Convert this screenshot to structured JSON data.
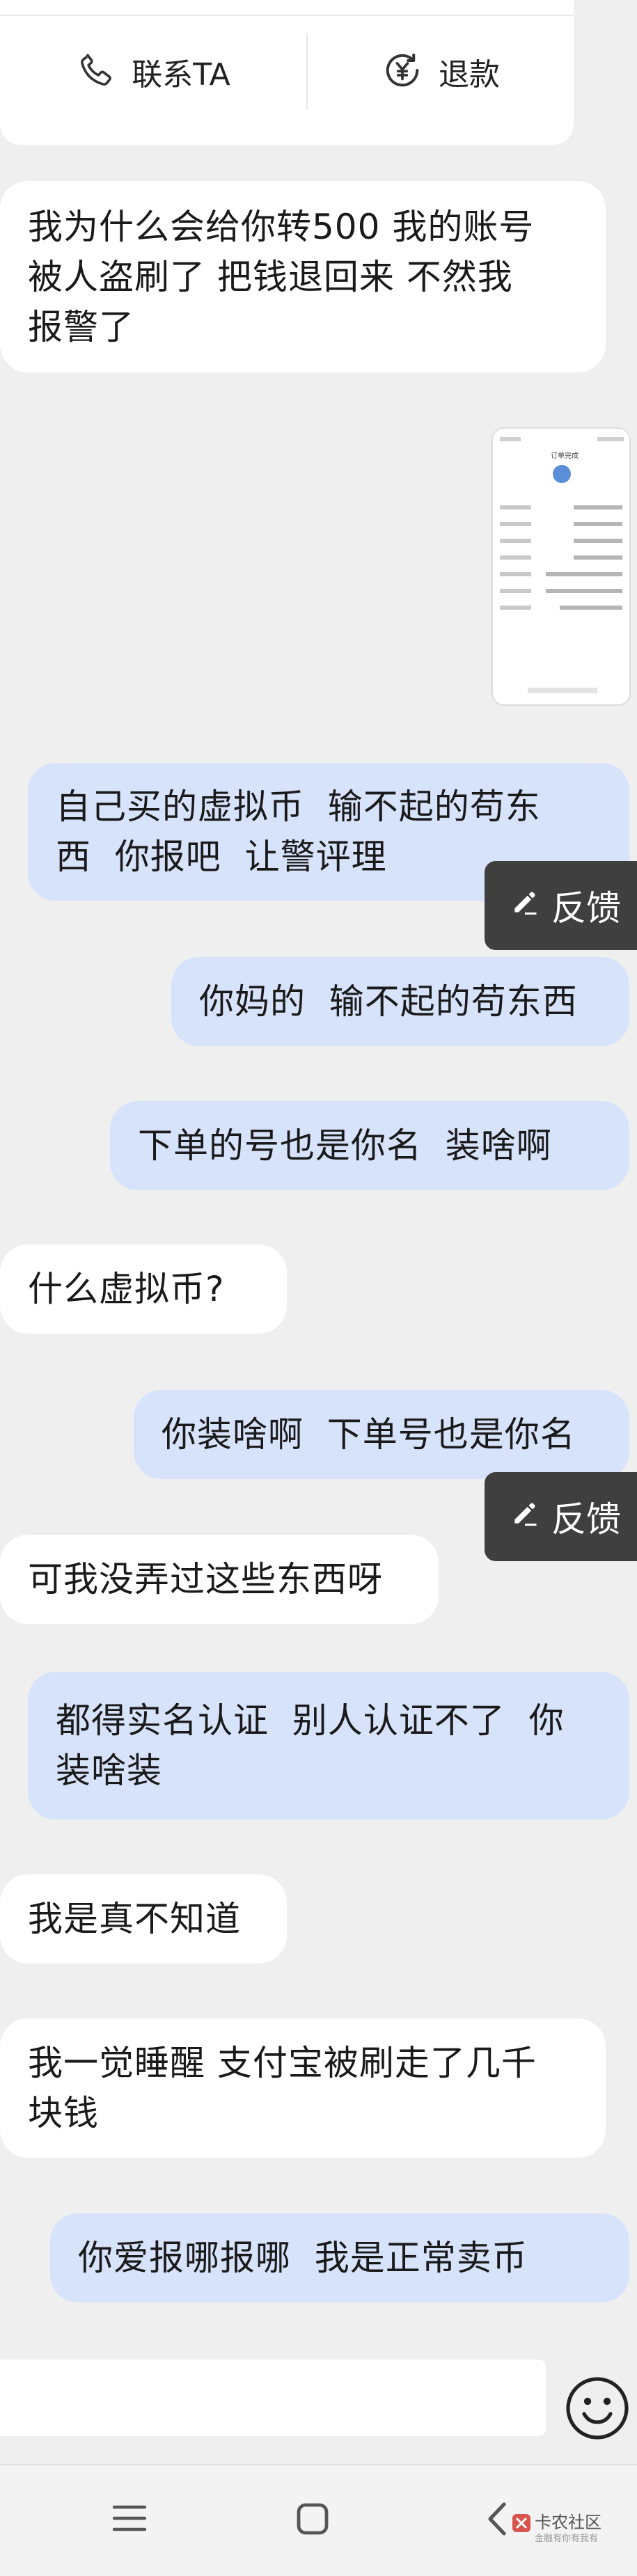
{
  "order_card": {
    "contact_label": "联系TA",
    "refund_label": "退款"
  },
  "messages": [
    {
      "side": "left",
      "text": "我为什么会给你转500 我的账号\n被人盗刷了 把钱退回来 不然我\n报警了"
    },
    {
      "side": "right",
      "text": "自己买的虚拟币  输不起的苟东\n西  你报吧  让警评理"
    },
    {
      "side": "right",
      "text": "你妈的  输不起的苟东西"
    },
    {
      "side": "right",
      "text": "下单的号也是你名  装啥啊"
    },
    {
      "side": "left",
      "text": "什么虚拟币?"
    },
    {
      "side": "right",
      "text": "你装啥啊  下单号也是你名"
    },
    {
      "side": "left",
      "text": "可我没弄过这些东西呀"
    },
    {
      "side": "right",
      "text": "都得实名认证  别人认证不了  你\n装啥装"
    },
    {
      "side": "left",
      "text": "我是真不知道"
    },
    {
      "side": "left",
      "text": "我一觉睡醒 支付宝被刷走了几千\n块钱"
    },
    {
      "side": "right",
      "text": "你爱报哪报哪  我是正常卖币"
    }
  ],
  "feedback": {
    "label": "反馈"
  },
  "screenshot_thumb": {
    "title": "订单完成"
  },
  "watermark": {
    "name": "卡农社区",
    "sub": "金融有你有我有"
  },
  "colors": {
    "background": "#efefef",
    "bubble_left": "#ffffff",
    "bubble_right": "#d7e3fb",
    "feedback_bg": "#3f3f3f"
  },
  "icons": {
    "contact": "phone-icon",
    "refund": "yuan-refund-icon",
    "feedback": "edit-pencil-icon",
    "emoji": "smiley-emoji-icon",
    "nav_menu": "recent-apps-icon",
    "nav_home": "home-square-icon",
    "nav_back": "back-chevron-icon"
  }
}
